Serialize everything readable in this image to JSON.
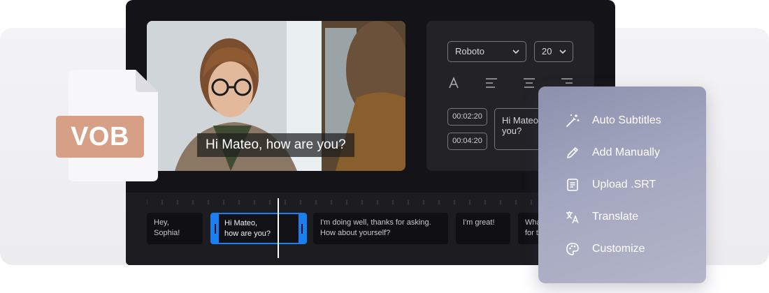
{
  "file_badge": {
    "label": "VOB"
  },
  "video": {
    "caption": "Hi Mateo, how are you?"
  },
  "style_panel": {
    "font": "Roboto",
    "size": "20",
    "tools": [
      "text-color-icon",
      "align-left-icon",
      "align-center-icon",
      "align-right-icon"
    ],
    "entries": [
      {
        "start": "00:02:20",
        "end": "00:04:20",
        "text": "Hi Mateo, how are you?"
      }
    ]
  },
  "timeline": {
    "clips": [
      {
        "line1": "Hey, Sophia!",
        "line2": ""
      },
      {
        "line1": "Hi Mateo,",
        "line2": "how are you?"
      },
      {
        "line1": "I'm doing well, thanks for asking.",
        "line2": "How about yourself?"
      },
      {
        "line1": "I'm great!",
        "line2": ""
      },
      {
        "line1": "What",
        "line2": "for t"
      }
    ]
  },
  "menu": {
    "items": [
      {
        "label": "Auto Subtitles",
        "icon": "magic-wand-icon"
      },
      {
        "label": "Add Manually",
        "icon": "pencil-icon"
      },
      {
        "label": "Upload .SRT",
        "icon": "document-icon"
      },
      {
        "label": "Translate",
        "icon": "translate-icon"
      },
      {
        "label": "Customize",
        "icon": "palette-icon"
      }
    ]
  },
  "colors": {
    "accent": "#1a7ff0",
    "file_badge": "#d7a086"
  }
}
